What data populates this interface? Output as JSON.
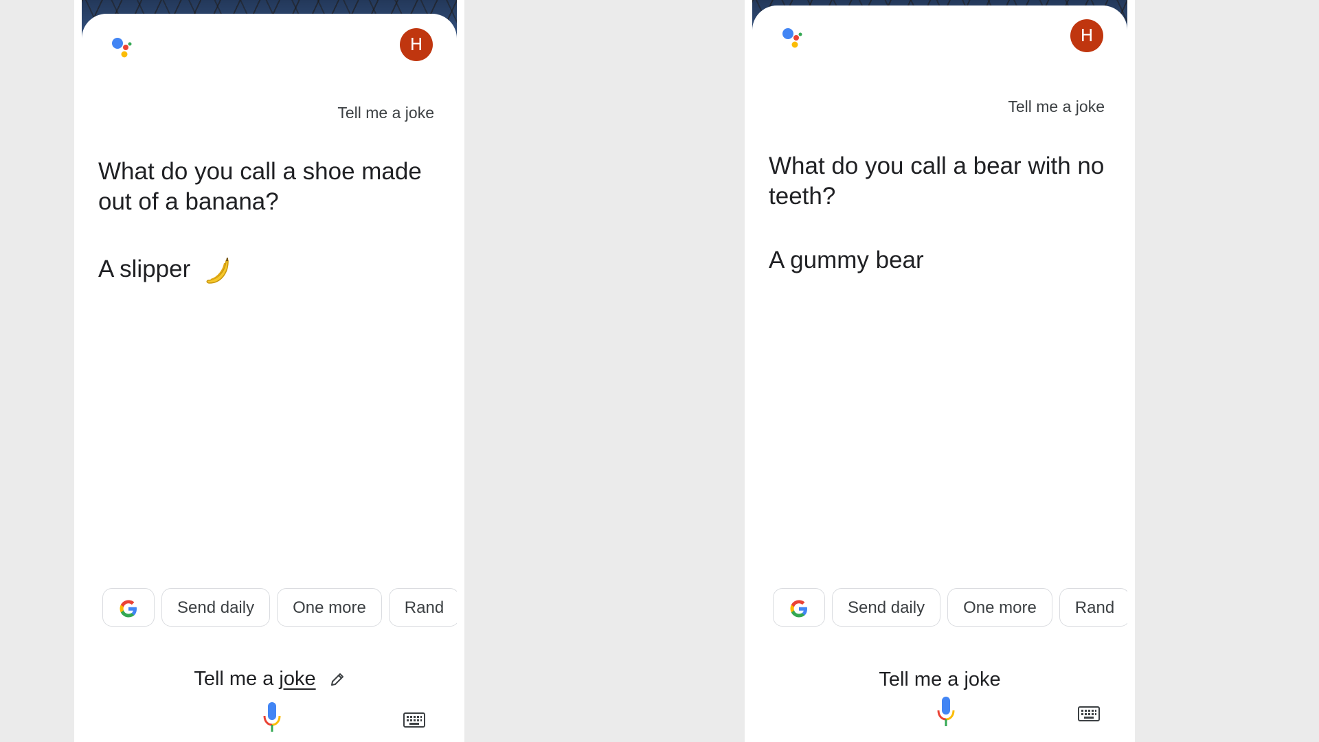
{
  "screens": [
    {
      "avatar_letter": "H",
      "user_query": "Tell me a joke",
      "joke_question": "What do you call a shoe made out of a banana?",
      "joke_answer": "A slipper",
      "answer_emoji": "banana-icon",
      "suggestion_chips": [
        "Send daily",
        "One more",
        "Rand"
      ],
      "input_text_prefix": "Tell me a ",
      "input_text_word": "joke",
      "input_editable": true
    },
    {
      "avatar_letter": "H",
      "user_query": "Tell me a joke",
      "joke_question": "What do you call a bear with no teeth?",
      "joke_answer": "A gummy bear",
      "suggestion_chips": [
        "Send daily",
        "One more",
        "Rand"
      ],
      "input_text_prefix": "Tell me a ",
      "input_text_word": "joke",
      "input_editable": false
    }
  ],
  "colors": {
    "avatar_bg": "#c0360f",
    "google_blue": "#4285f4",
    "google_red": "#ea4335",
    "google_yellow": "#fbbc05",
    "google_green": "#34a853",
    "background": "#ebebeb"
  },
  "icons": [
    "assistant-logo-icon",
    "google-g-icon",
    "microphone-icon",
    "keyboard-icon",
    "pencil-icon",
    "banana-icon"
  ]
}
